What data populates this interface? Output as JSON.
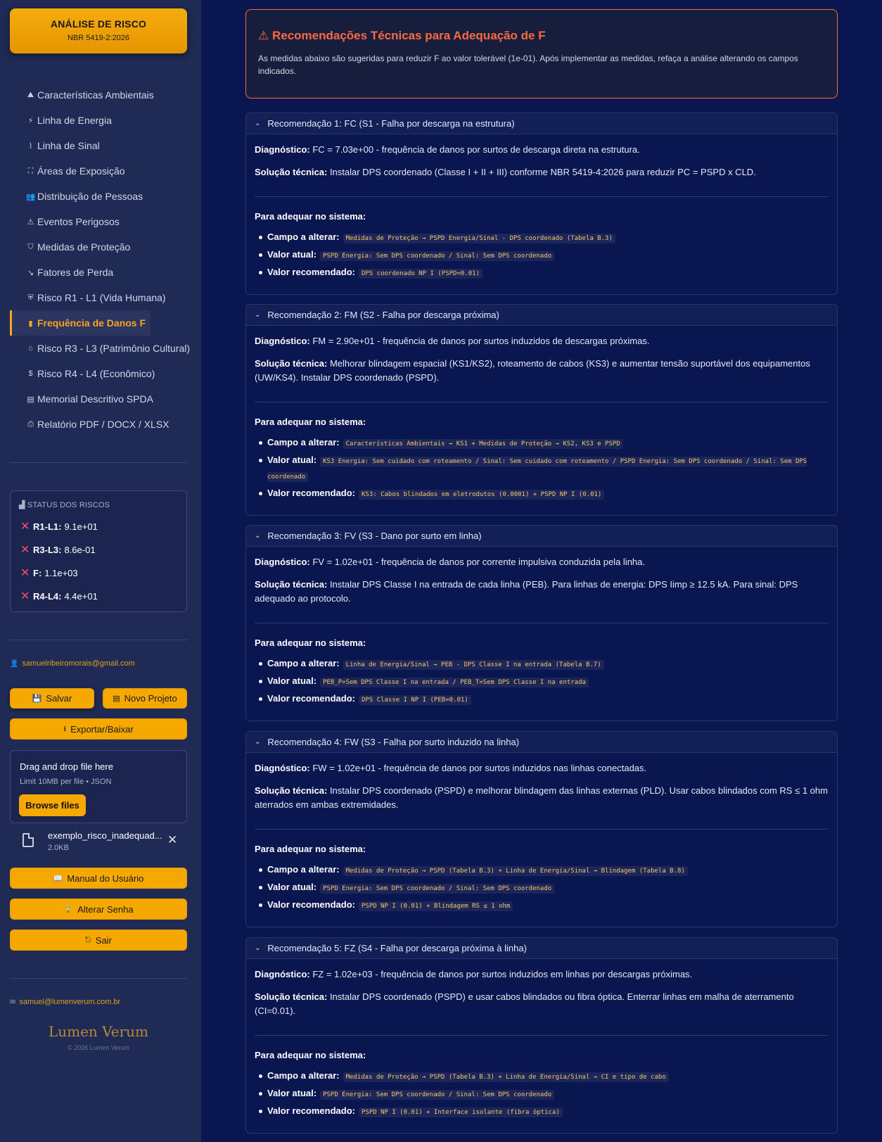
{
  "sidebar": {
    "brand_title": "ANÁLISE DE RISCO",
    "brand_subtitle": "NBR 5419-2:2026",
    "nav": [
      {
        "label": "Características Ambientais",
        "icon": "landscape-icon"
      },
      {
        "label": "Linha de Energia",
        "icon": "plug-icon"
      },
      {
        "label": "Linha de Sinal",
        "icon": "antenna-icon"
      },
      {
        "label": "Áreas de Exposição",
        "icon": "expand-icon"
      },
      {
        "label": "Distribuição de Pessoas",
        "icon": "people-icon"
      },
      {
        "label": "Eventos Perigosos",
        "icon": "warning-icon"
      },
      {
        "label": "Medidas de Proteção",
        "icon": "shield-icon"
      },
      {
        "label": "Fatores de Perda",
        "icon": "trend-down-icon"
      },
      {
        "label": "Risco R1 - L1 (Vida Humana)",
        "icon": "shield-heart-icon"
      },
      {
        "label": "Frequência de Danos F",
        "icon": "bar-chart-icon",
        "active": true
      },
      {
        "label": "Risco R3 - L3 (Patrimônio Cultural)",
        "icon": "museum-icon"
      },
      {
        "label": "Risco R4 - L4 (Econômico)",
        "icon": "dollar-icon"
      },
      {
        "label": "Memorial Descritivo SPDA",
        "icon": "document-icon"
      },
      {
        "label": "Relatório PDF / DOCX / XLSX",
        "icon": "printer-icon"
      }
    ],
    "status": {
      "title": "STATUS DOS RISCOS",
      "items": [
        {
          "label": "R1-L1:",
          "value": "9.1e+01"
        },
        {
          "label": "R3-L3:",
          "value": "8.6e-01"
        },
        {
          "label": "F:",
          "value": "1.1e+03"
        },
        {
          "label": "R4-L4:",
          "value": "4.4e+01"
        }
      ]
    },
    "user_email": "samuelribeiromorais@gmail.com",
    "buttons": {
      "save": "Salvar",
      "new_project": "Novo Projeto",
      "export": "Exportar/Baixar",
      "manual": "Manual do Usuário",
      "change_password": "Alterar Senha",
      "logout": "Sair"
    },
    "upload": {
      "title": "Drag and drop file here",
      "limit": "Limit 10MB per file • JSON",
      "browse": "Browse files",
      "file_name": "exemplo_risco_inadequad...",
      "file_size": "2.0KB"
    },
    "contact_email": "samuel@lumenverum.com.br",
    "logo_text": "Lumen Verum",
    "copyright": "© 2026 Lumen Verum"
  },
  "main": {
    "alert": {
      "title": "Recomendações Técnicas para Adequação de F",
      "text": "As medidas abaixo são sugeridas para reduzir F ao valor tolerável (1e-01). Após implementar as medidas, refaça a análise alterando os campos indicados."
    },
    "labels": {
      "diagnostico": "Diagnóstico:",
      "solucao": "Solução técnica:",
      "para_adequar": "Para adequar no sistema:",
      "campo": "Campo a alterar:",
      "valor_atual": "Valor atual:",
      "valor_recomendado": "Valor recomendado:"
    },
    "recommendations": [
      {
        "title": "Recomendação 1: FC (S1 - Falha por descarga na estrutura)",
        "diagnostico": "FC = 7.03e+00 - frequência de danos por surtos de descarga direta na estrutura.",
        "solucao": "Instalar DPS coordenado (Classe I + II + III) conforme NBR 5419-4:2026 para reduzir PC = PSPD x CLD.",
        "campo": "Medidas de Proteção → PSPD Energia/Sinal - DPS coordenado (Tabela B.3)",
        "valor_atual": "PSPD Energia: Sem DPS coordenado / Sinal: Sem DPS coordenado",
        "valor_recomendado": "DPS coordenado NP I (PSPD=0.01)"
      },
      {
        "title": "Recomendação 2: FM (S2 - Falha por descarga próxima)",
        "diagnostico": "FM = 2.90e+01 - frequência de danos por surtos induzidos de descargas próximas.",
        "solucao": "Melhorar blindagem espacial (KS1/KS2), roteamento de cabos (KS3) e aumentar tensão suportável dos equipamentos (UW/KS4). Instalar DPS coordenado (PSPD).",
        "campo": "Características Ambientais → KS1 + Medidas de Proteção → KS2, KS3 e PSPD",
        "valor_atual": "KS3 Energia: Sem cuidado com roteamento / Sinal: Sem cuidado com roteamento / PSPD Energia: Sem DPS coordenado / Sinal: Sem DPS coordenado",
        "valor_recomendado": "KS3: Cabos blindados em eletrodutos (0.0001) + PSPD NP I (0.01)"
      },
      {
        "title": "Recomendação 3: FV (S3 - Dano por surto em linha)",
        "diagnostico": "FV = 1.02e+01 - frequência de danos por corrente impulsiva conduzida pela linha.",
        "solucao": "Instalar DPS Classe I na entrada de cada linha (PEB). Para linhas de energia: DPS Iimp ≥ 12.5 kA. Para sinal: DPS adequado ao protocolo.",
        "campo": "Linha de Energia/Sinal → PEB - DPS Classe I na entrada (Tabela B.7)",
        "valor_atual": "PEB_P=Sem DPS Classe I na entrada / PEB_T=Sem DPS Classe I na entrada",
        "valor_recomendado": "DPS Classe I NP I (PEB=0.01)"
      },
      {
        "title": "Recomendação 4: FW (S3 - Falha por surto induzido na linha)",
        "diagnostico": "FW = 1.02e+01 - frequência de danos por surtos induzidos nas linhas conectadas.",
        "solucao": "Instalar DPS coordenado (PSPD) e melhorar blindagem das linhas externas (PLD). Usar cabos blindados com RS ≤ 1 ohm aterrados em ambas extremidades.",
        "campo": "Medidas de Proteção → PSPD (Tabela B.3) + Linha de Energia/Sinal → Blindagem (Tabela B.8)",
        "valor_atual": "PSPD Energia: Sem DPS coordenado / Sinal: Sem DPS coordenado",
        "valor_recomendado": "PSPD NP I (0.01) + Blindagem RS ≤ 1 ohm"
      },
      {
        "title": "Recomendação 5: FZ (S4 - Falha por descarga próxima à linha)",
        "diagnostico": "FZ = 1.02e+03 - frequência de danos por surtos induzidos em linhas por descargas próximas.",
        "solucao": "Instalar DPS coordenado (PSPD) e usar cabos blindados ou fibra óptica. Enterrar linhas em malha de aterramento (CI=0.01).",
        "campo": "Medidas de Proteção → PSPD (Tabela B.3) + Linha de Energia/Sinal → CI e tipo de cabo",
        "valor_atual": "PSPD Energia: Sem DPS coordenado / Sinal: Sem DPS coordenado",
        "valor_recomendado": "PSPD NP I (0.01) + Interface isolante (fibra óptica)"
      }
    ]
  }
}
